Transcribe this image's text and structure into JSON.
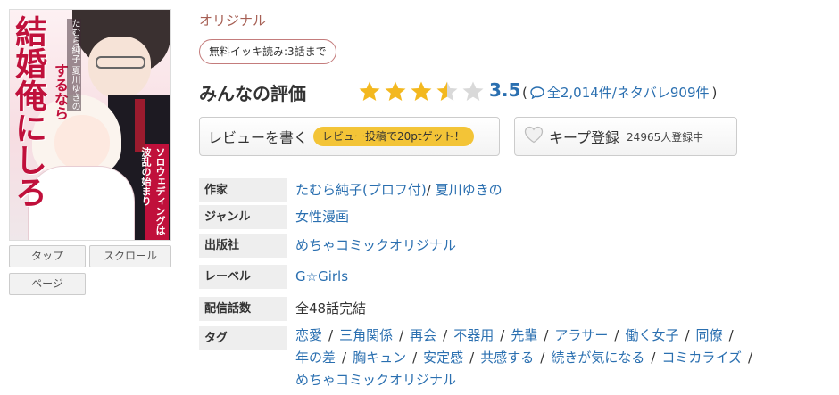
{
  "cover": {
    "title_main": "結婚俺にしろ",
    "title_sub": "するなら",
    "author_text": "たむら純子 夏川ゆきの",
    "catchcopy": "ソロウェディングは波乱の始まり"
  },
  "viewer_buttons": {
    "tap": "タップ",
    "scroll": "スクロール",
    "page": "ページ"
  },
  "label": "オリジナル",
  "free_badge": "無料イッキ読み:3話まで",
  "rating": {
    "title": "みんなの評価",
    "score": "3.5",
    "value": 3.5,
    "max": 5,
    "open_paren": "(",
    "total": "全2,014件/ネタバレ909件",
    "close_paren": ")",
    "star_color": "#f3b81f",
    "empty_color": "#d9d9d9"
  },
  "review_button": {
    "label": "レビューを書く",
    "points": "レビュー投稿で20ptゲット！"
  },
  "keep_button": {
    "label": "キープ登録",
    "count": "24965人登録中"
  },
  "info": {
    "author": {
      "key": "作家",
      "names": [
        "たむら純子(プロフ付)",
        "夏川ゆきの"
      ],
      "separator": "/"
    },
    "genre": {
      "key": "ジャンル",
      "value": "女性漫画"
    },
    "publisher": {
      "key": "出版社",
      "value": "めちゃコミックオリジナル"
    },
    "label": {
      "key": "レーベル",
      "value": "G☆Girls"
    },
    "episodes": {
      "key": "配信話数",
      "value": "全48話完結"
    },
    "tags": {
      "key": "タグ",
      "line1": [
        "恋愛",
        "三角関係",
        "再会",
        "不器用",
        "先輩",
        "アラサー",
        "働く女子",
        "同僚"
      ],
      "line2": [
        "年の差",
        "胸キュン",
        "安定感",
        "共感する",
        "続きが気になる",
        "コミカライズ"
      ],
      "line3": [
        "めちゃコミックオリジナル"
      ],
      "separator": "/"
    }
  },
  "colors": {
    "link": "#2a6fb0",
    "score": "#2a6fb0",
    "label": "#a65f54"
  }
}
